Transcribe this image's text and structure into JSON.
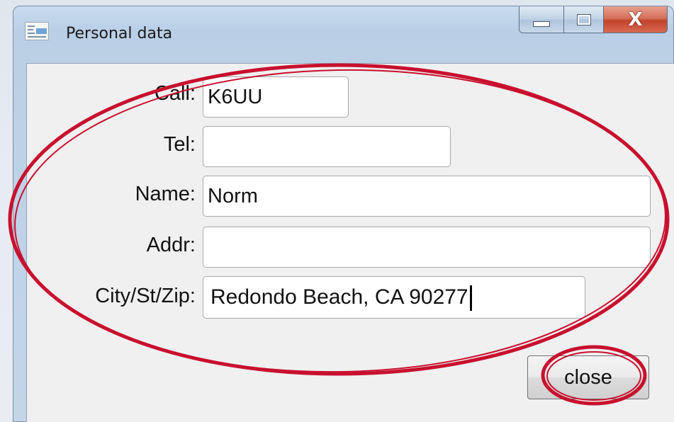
{
  "window": {
    "title": "Personal data",
    "icon": "app-document-icon",
    "controls": {
      "minimize_icon": "minimize-icon",
      "maximize_icon": "maximize-icon",
      "close_glyph": "X"
    }
  },
  "form": {
    "call": {
      "label": "Call:",
      "value": "K6UU"
    },
    "tel": {
      "label": "Tel:",
      "value": ""
    },
    "name": {
      "label": "Name:",
      "value": "Norm"
    },
    "addr": {
      "label": "Addr:",
      "value": ""
    },
    "city": {
      "label": "City/St/Zip:",
      "value": "Redondo Beach, CA 90277"
    }
  },
  "actions": {
    "close_label": "close"
  },
  "annotations": {
    "color": "#c8102e"
  }
}
